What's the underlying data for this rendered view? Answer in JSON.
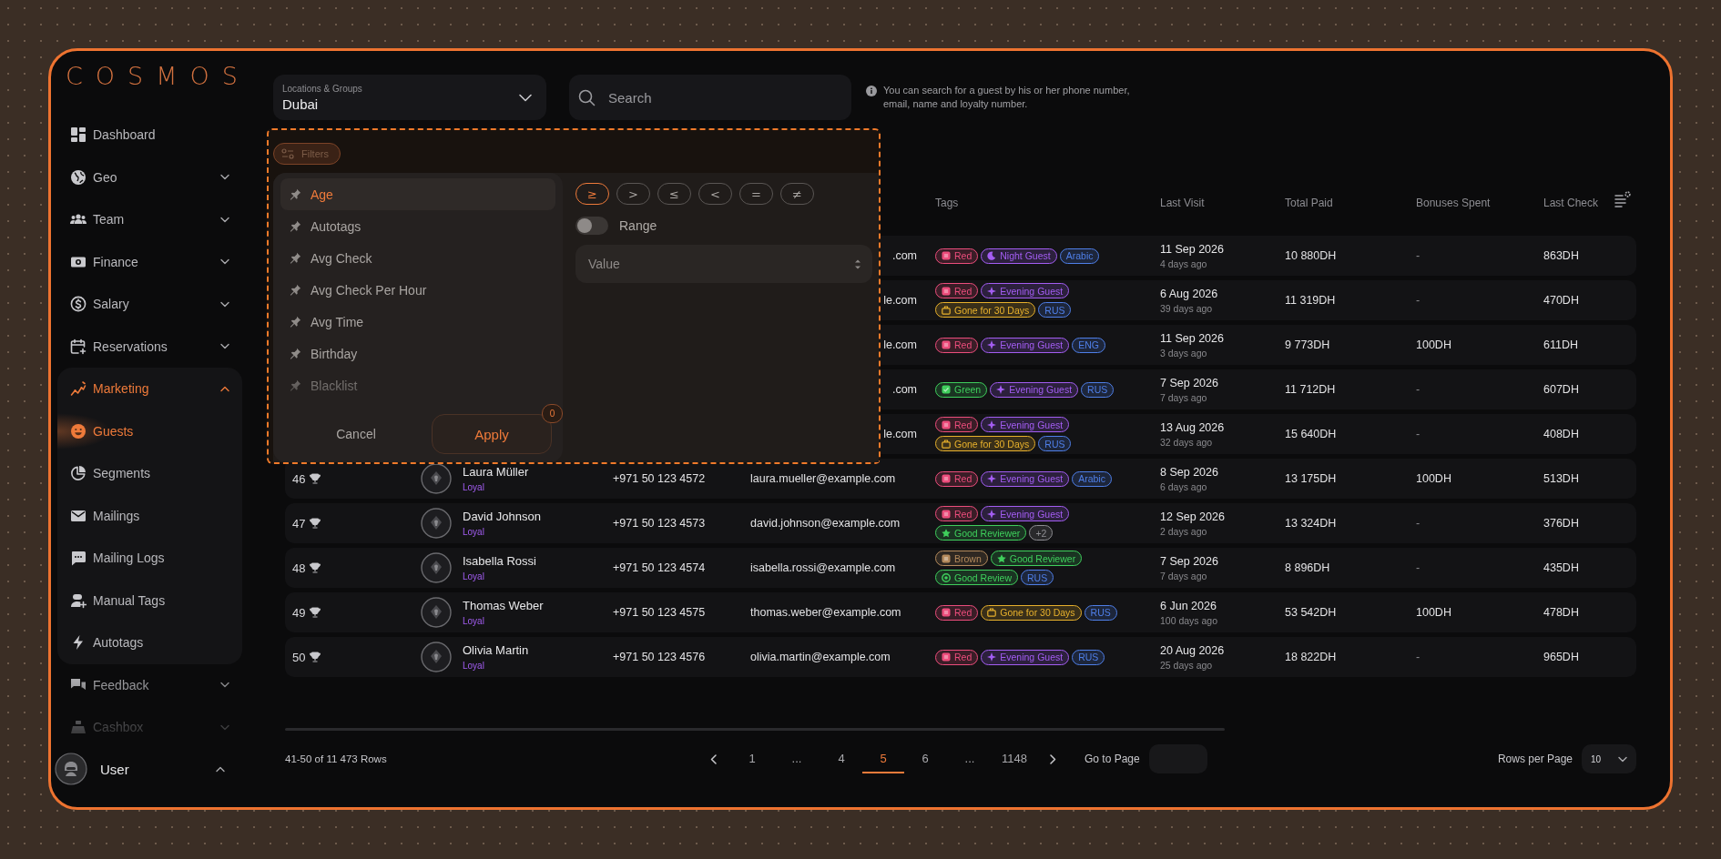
{
  "logo": "COSMOS",
  "sidebar": {
    "items": [
      {
        "label": "Dashboard",
        "expandable": false,
        "selected": false
      },
      {
        "label": "Geo",
        "expandable": true,
        "expanded": false,
        "selected": false
      },
      {
        "label": "Team",
        "expandable": true,
        "expanded": false,
        "selected": false
      },
      {
        "label": "Finance",
        "expandable": true,
        "expanded": false,
        "selected": false
      },
      {
        "label": "Salary",
        "expandable": true,
        "expanded": false,
        "selected": false
      },
      {
        "label": "Reservations",
        "expandable": true,
        "expanded": false,
        "selected": false
      },
      {
        "label": "Marketing",
        "expandable": true,
        "expanded": true,
        "selected": true,
        "children": [
          {
            "label": "Guests",
            "selected": true
          },
          {
            "label": "Segments",
            "selected": false
          },
          {
            "label": "Mailings",
            "selected": false
          },
          {
            "label": "Mailing Logs",
            "selected": false
          },
          {
            "label": "Manual Tags",
            "selected": false
          },
          {
            "label": "Autotags",
            "selected": false
          }
        ]
      },
      {
        "label": "Feedback",
        "expandable": true,
        "expanded": false,
        "selected": false
      },
      {
        "label": "Cashbox",
        "expandable": true,
        "expanded": false,
        "selected": false
      }
    ]
  },
  "user": {
    "name": "User",
    "expanded": true
  },
  "location_select": {
    "label": "Locations & Groups",
    "value": "Dubai"
  },
  "search": {
    "placeholder": "Search"
  },
  "search_hint": "You can search for a guest by his or her phone number, email, name and loyalty number.",
  "filters": {
    "button": "Filters",
    "fields": [
      {
        "label": "Age",
        "selected": true
      },
      {
        "label": "Autotags",
        "selected": false
      },
      {
        "label": "Avg Check",
        "selected": false
      },
      {
        "label": "Avg Check Per Hour",
        "selected": false
      },
      {
        "label": "Avg Time",
        "selected": false
      },
      {
        "label": "Birthday",
        "selected": false
      },
      {
        "label": "Blacklist",
        "selected": false
      }
    ],
    "operators": [
      {
        "symbol": "≥",
        "selected": true
      },
      {
        "symbol": ">",
        "selected": false
      },
      {
        "symbol": "≤",
        "selected": false
      },
      {
        "symbol": "<",
        "selected": false
      },
      {
        "symbol": "=",
        "selected": false
      },
      {
        "symbol": "≠",
        "selected": false
      }
    ],
    "range": {
      "label": "Range",
      "on": false
    },
    "value_field": {
      "placeholder": "Value"
    },
    "cancel": "Cancel",
    "apply": "Apply",
    "apply_count": "0"
  },
  "table": {
    "columns": [
      "Tags",
      "Last Visit",
      "Total Paid",
      "Bonuses Spent",
      "Last Check"
    ],
    "rows": [
      {
        "email": ".com",
        "tags": [
          {
            "label": "Red",
            "kind": "square",
            "color": "#ec4d7c"
          },
          {
            "label": "Night Guest",
            "kind": "moon",
            "color": "#a35df2"
          },
          {
            "label": "Arabic",
            "kind": "plain",
            "color": "#4f7fe8"
          }
        ],
        "last_visit": "11 Sep 2026",
        "visit_ago": "4 days ago",
        "total_paid": "10 880DH",
        "bonuses_spent": "-",
        "last_check": "863DH"
      },
      {
        "email": "le.com",
        "tags": [
          {
            "label": "Red",
            "kind": "square",
            "color": "#ec4d7c"
          },
          {
            "label": "Evening Guest",
            "kind": "sparkle",
            "color": "#a35df2"
          },
          {
            "label": "Gone for 30 Days",
            "kind": "case",
            "color": "#e8b12c"
          },
          {
            "label": "RUS",
            "kind": "plain",
            "color": "#4f7fe8"
          }
        ],
        "last_visit": "6 Aug 2026",
        "visit_ago": "39 days ago",
        "total_paid": "11 319DH",
        "bonuses_spent": "-",
        "last_check": "470DH"
      },
      {
        "email": "le.com",
        "tags": [
          {
            "label": "Red",
            "kind": "square",
            "color": "#ec4d7c"
          },
          {
            "label": "Evening Guest",
            "kind": "sparkle",
            "color": "#a35df2"
          },
          {
            "label": "ENG",
            "kind": "plain",
            "color": "#4f7fe8"
          }
        ],
        "last_visit": "11 Sep 2026",
        "visit_ago": "3 days ago",
        "total_paid": "9 773DH",
        "bonuses_spent": "100DH",
        "last_check": "611DH"
      },
      {
        "email": ".com",
        "tags": [
          {
            "label": "Green",
            "kind": "check",
            "color": "#3fcf5c"
          },
          {
            "label": "Evening Guest",
            "kind": "sparkle",
            "color": "#a35df2"
          },
          {
            "label": "RUS",
            "kind": "plain",
            "color": "#4f7fe8"
          }
        ],
        "last_visit": "7 Sep 2026",
        "visit_ago": "7 days ago",
        "total_paid": "11 712DH",
        "bonuses_spent": "-",
        "last_check": "607DH"
      },
      {
        "email": "le.com",
        "tags": [
          {
            "label": "Red",
            "kind": "square",
            "color": "#ec4d7c"
          },
          {
            "label": "Evening Guest",
            "kind": "sparkle",
            "color": "#a35df2"
          },
          {
            "label": "Gone for 30 Days",
            "kind": "case",
            "color": "#e8b12c"
          },
          {
            "label": "RUS",
            "kind": "plain",
            "color": "#4f7fe8"
          }
        ],
        "last_visit": "13 Aug 2026",
        "visit_ago": "32 days ago",
        "total_paid": "15 640DH",
        "bonuses_spent": "-",
        "last_check": "408DH"
      },
      {
        "number": "46",
        "name": "Laura Müller",
        "status": "Loyal",
        "phone": "+971 50 123 4572",
        "email": "laura.mueller@example.com",
        "tags": [
          {
            "label": "Red",
            "kind": "square",
            "color": "#ec4d7c"
          },
          {
            "label": "Evening Guest",
            "kind": "sparkle",
            "color": "#a35df2"
          },
          {
            "label": "Arabic",
            "kind": "plain",
            "color": "#4f7fe8"
          }
        ],
        "last_visit": "8 Sep 2026",
        "visit_ago": "6 days ago",
        "total_paid": "13 175DH",
        "bonuses_spent": "100DH",
        "last_check": "513DH"
      },
      {
        "number": "47",
        "name": "David Johnson",
        "status": "Loyal",
        "phone": "+971 50 123 4573",
        "email": "david.johnson@example.com",
        "tags": [
          {
            "label": "Red",
            "kind": "square",
            "color": "#ec4d7c"
          },
          {
            "label": "Evening Guest",
            "kind": "sparkle",
            "color": "#a35df2"
          },
          {
            "label": "Good Reviewer",
            "kind": "star",
            "color": "#3fcf5c"
          },
          {
            "label": "+2",
            "kind": "plain",
            "color": "#8e8e92"
          }
        ],
        "last_visit": "12 Sep 2026",
        "visit_ago": "2 days ago",
        "total_paid": "13 324DH",
        "bonuses_spent": "-",
        "last_check": "376DH"
      },
      {
        "number": "48",
        "name": "Isabella Rossi",
        "status": "Loyal",
        "phone": "+971 50 123 4574",
        "email": "isabella.rossi@example.com",
        "tags": [
          {
            "label": "Brown",
            "kind": "square",
            "color": "#b48a5c"
          },
          {
            "label": "Good Reviewer",
            "kind": "star",
            "color": "#3fcf5c"
          },
          {
            "label": "Good Review",
            "kind": "dot",
            "color": "#3fcf5c"
          },
          {
            "label": "RUS",
            "kind": "plain",
            "color": "#4f7fe8"
          }
        ],
        "last_visit": "7 Sep 2026",
        "visit_ago": "7 days ago",
        "total_paid": "8 896DH",
        "bonuses_spent": "-",
        "last_check": "435DH"
      },
      {
        "number": "49",
        "name": "Thomas Weber",
        "status": "Loyal",
        "phone": "+971 50 123 4575",
        "email": "thomas.weber@example.com",
        "tags": [
          {
            "label": "Red",
            "kind": "square",
            "color": "#ec4d7c"
          },
          {
            "label": "Gone for 30 Days",
            "kind": "case",
            "color": "#e8b12c"
          },
          {
            "label": "RUS",
            "kind": "plain",
            "color": "#4f7fe8"
          }
        ],
        "last_visit": "6 Jun 2026",
        "visit_ago": "100 days ago",
        "total_paid": "53 542DH",
        "bonuses_spent": "100DH",
        "last_check": "478DH"
      },
      {
        "number": "50",
        "name": "Olivia Martin",
        "status": "Loyal",
        "phone": "+971 50 123 4576",
        "email": "olivia.martin@example.com",
        "tags": [
          {
            "label": "Red",
            "kind": "square",
            "color": "#ec4d7c"
          },
          {
            "label": "Evening Guest",
            "kind": "sparkle",
            "color": "#a35df2"
          },
          {
            "label": "RUS",
            "kind": "plain",
            "color": "#4f7fe8"
          }
        ],
        "last_visit": "20 Aug 2026",
        "visit_ago": "25 days ago",
        "total_paid": "18 822DH",
        "bonuses_spent": "-",
        "last_check": "965DH"
      }
    ]
  },
  "pagination": {
    "range_text": "41-50 of 11 473 Rows",
    "pages": [
      {
        "label": "1",
        "kind": "page",
        "selected": false
      },
      {
        "label": "...",
        "kind": "ellipsis",
        "selected": false
      },
      {
        "label": "4",
        "kind": "page",
        "selected": false
      },
      {
        "label": "5",
        "kind": "page",
        "selected": true
      },
      {
        "label": "6",
        "kind": "page",
        "selected": false
      },
      {
        "label": "...",
        "kind": "ellipsis",
        "selected": false
      },
      {
        "label": "1148",
        "kind": "page",
        "selected": false
      }
    ],
    "go_to_label": "Go to Page",
    "rows_per_page_label": "Rows per Page",
    "rows_per_page": "10"
  }
}
